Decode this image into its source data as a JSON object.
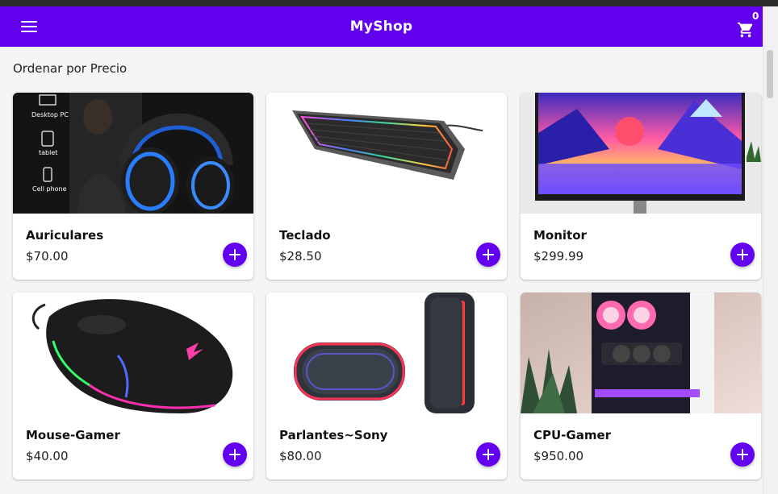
{
  "header": {
    "title": "MyShop",
    "cart_count": "0"
  },
  "sort": {
    "label": "Ordenar por Precio"
  },
  "products": [
    {
      "name": "Auriculares",
      "price": "$70.00",
      "image": "headphones-image",
      "device_labels": [
        "Desktop PC",
        "tablet",
        "Cell phone"
      ]
    },
    {
      "name": "Teclado",
      "price": "$28.50",
      "image": "keyboard-image"
    },
    {
      "name": "Monitor",
      "price": "$299.99",
      "image": "monitor-image"
    },
    {
      "name": "Mouse-Gamer",
      "price": "$40.00",
      "image": "mouse-image"
    },
    {
      "name": "Parlantes~Sony",
      "price": "$80.00",
      "image": "speaker-image"
    },
    {
      "name": "CPU-Gamer",
      "price": "$950.00",
      "image": "pc-case-image"
    }
  ],
  "colors": {
    "primary": "#6200ee",
    "background": "#f5f5f5",
    "card": "#ffffff"
  }
}
